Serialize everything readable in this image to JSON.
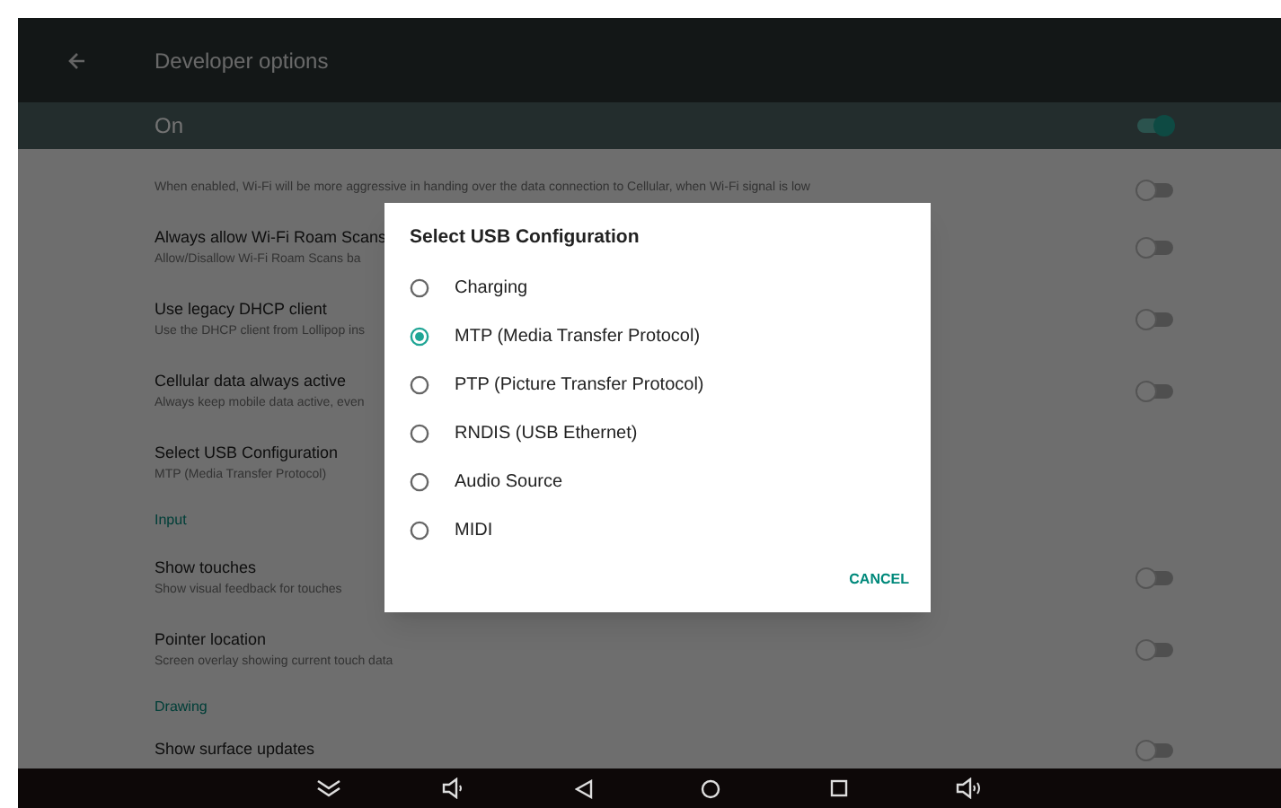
{
  "app_bar": {
    "title": "Developer options"
  },
  "master_switch": {
    "label": "On",
    "on": true
  },
  "list": [
    {
      "kind": "partial",
      "subtitle": "When enabled, Wi-Fi will be more aggressive in handing over the data connection to Cellular, when Wi-Fi signal is low",
      "on": false
    },
    {
      "kind": "switch",
      "title": "Always allow Wi-Fi Roam Scans",
      "subtitle": "Allow/Disallow Wi-Fi Roam Scans ba",
      "on": false
    },
    {
      "kind": "switch",
      "title": "Use legacy DHCP client",
      "subtitle": "Use the DHCP client from Lollipop ins",
      "on": false
    },
    {
      "kind": "switch",
      "title": "Cellular data always active",
      "subtitle": "Always keep mobile data active, even",
      "on": false
    },
    {
      "kind": "item",
      "title": "Select USB Configuration",
      "subtitle": "MTP (Media Transfer Protocol)"
    },
    {
      "kind": "header",
      "title": "Input"
    },
    {
      "kind": "switch",
      "title": "Show touches",
      "subtitle": "Show visual feedback for touches",
      "on": false
    },
    {
      "kind": "switch",
      "title": "Pointer location",
      "subtitle": "Screen overlay showing current touch data",
      "on": false
    },
    {
      "kind": "header",
      "title": "Drawing"
    },
    {
      "kind": "switch",
      "title": "Show surface updates",
      "on": false
    }
  ],
  "dialog": {
    "title": "Select USB Configuration",
    "options": [
      {
        "label": "Charging",
        "selected": false
      },
      {
        "label": "MTP (Media Transfer Protocol)",
        "selected": true
      },
      {
        "label": "PTP (Picture Transfer Protocol)",
        "selected": false
      },
      {
        "label": "RNDIS (USB Ethernet)",
        "selected": false
      },
      {
        "label": "Audio Source",
        "selected": false
      },
      {
        "label": "MIDI",
        "selected": false
      }
    ],
    "button": "CANCEL"
  }
}
